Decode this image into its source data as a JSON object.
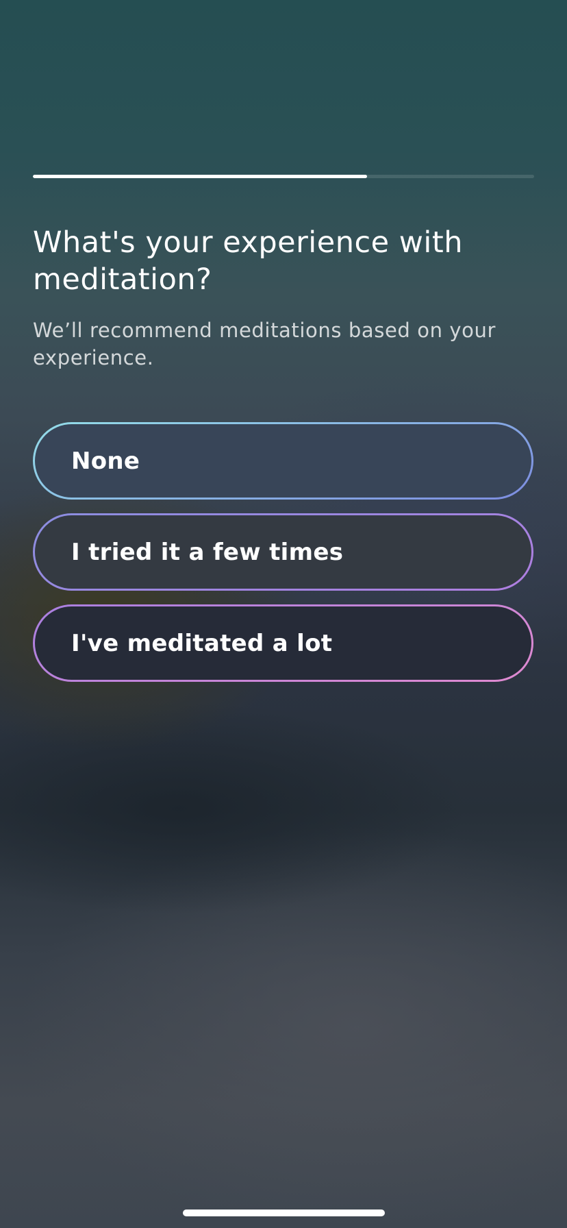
{
  "progress": {
    "fraction": 0.667,
    "fill_color": "#ffffff"
  },
  "question": {
    "title": "What's your experience with meditation?",
    "subtitle": "We’ll recommend meditations based on your experience."
  },
  "options": [
    {
      "label": "None",
      "border_gradient": [
        "#94dde8",
        "#7d8ce0"
      ],
      "fill_color": "#384558"
    },
    {
      "label": "I tried it a few times",
      "border_gradient": [
        "#8b8ee0",
        "#b07ee0"
      ],
      "fill_color": "#343a42"
    },
    {
      "label": "I've meditated a lot",
      "border_gradient": [
        "#a97fe0",
        "#e08ad0"
      ],
      "fill_color": "#262b38"
    }
  ],
  "colors": {
    "background_top": "#254e52",
    "background_bottom": "#3e4650",
    "text_primary": "#ffffff"
  }
}
